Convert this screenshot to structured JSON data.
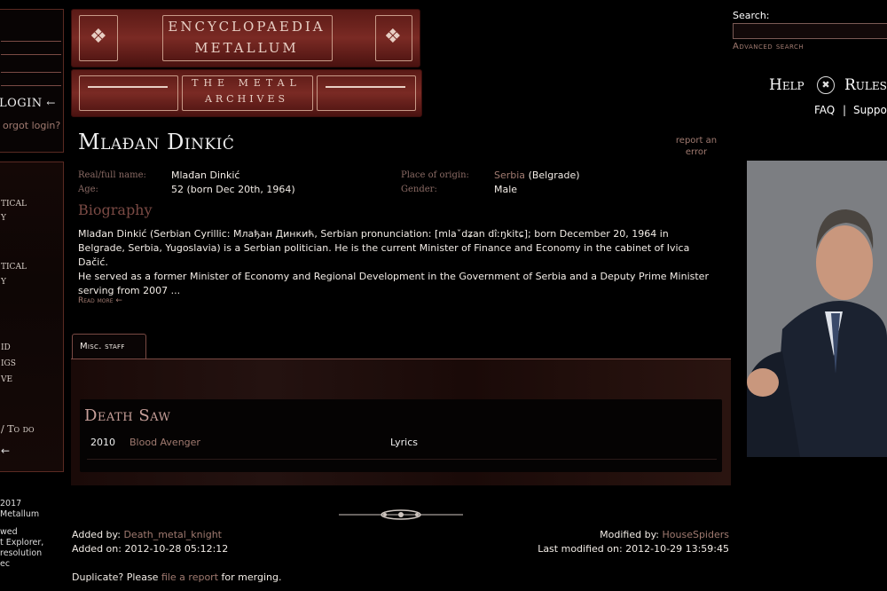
{
  "sidebar": {
    "login_label": "LOGIN",
    "forgot_label": "orgot login?",
    "menu_items": [
      "TICAL",
      "Y",
      "TICAL",
      "Y",
      "ID",
      "IGS",
      "VE",
      "/ To do"
    ],
    "footer_lines": [
      "2017",
      "Metallum",
      "",
      "wed",
      "t Explorer,",
      "resolution",
      "ec"
    ]
  },
  "logo": {
    "line1": "ENCYCLOPAEDIA",
    "line2": "METALLUM",
    "line3": "THE METAL",
    "line4": "ARCHIVES"
  },
  "header": {
    "search_label": "Search:",
    "search_value": "",
    "advanced_search": "Advanced search",
    "help": "Help",
    "rules": "Rules",
    "faq": "FAQ",
    "separator": "|",
    "support": "Suppor"
  },
  "artist": {
    "name": "Mlađan Dinkić",
    "report_error": "report an error",
    "real_name_label": "Real/full name:",
    "real_name": "Mlađan Dinkić",
    "age_label": "Age:",
    "age": "52 (born Dec 20th, 1964)",
    "origin_label": "Place of origin:",
    "origin_country": "Serbia",
    "origin_city": "(Belgrade)",
    "gender_label": "Gender:",
    "gender": "Male"
  },
  "biography": {
    "title": "Biography",
    "p1": "Mlađan Dinkić (Serbian Cyrillic: Млађан Динкић, Serbian pronunciation: [mlaˇdʑan dîːŋkitɕ]; born December 20, 1964 in Belgrade, Serbia, Yugoslavia) is a Serbian politician. He is the current Minister of Finance and Economy in the cabinet of Ivica Dačić.",
    "p2": "He served as a former Minister of Economy and Regional Development in the Government of Serbia and a Deputy Prime Minister serving from 2007 ...",
    "read_more": "Read more"
  },
  "tabs": [
    {
      "label": "Misc. staff"
    }
  ],
  "band": {
    "name": "Death Saw",
    "rows": [
      {
        "year": "2010",
        "album": "Blood Avenger",
        "role": "Lyrics"
      }
    ]
  },
  "meta": {
    "added_by_label": "Added by:",
    "added_by": "Death_metal_knight",
    "added_on_label": "Added on:",
    "added_on": "2012-10-28 05:12:12",
    "modified_by_label": "Modified by:",
    "modified_by": "HouseSpiders",
    "last_modified_label": "Last modified on:",
    "last_modified": "2012-10-29 13:59:45",
    "duplicate_prefix": "Duplicate? Please",
    "duplicate_link": "file a report",
    "duplicate_suffix": "for merging."
  },
  "colors": {
    "background": "#000000",
    "accent_link": "#a07a70",
    "border": "#7a4a44"
  }
}
